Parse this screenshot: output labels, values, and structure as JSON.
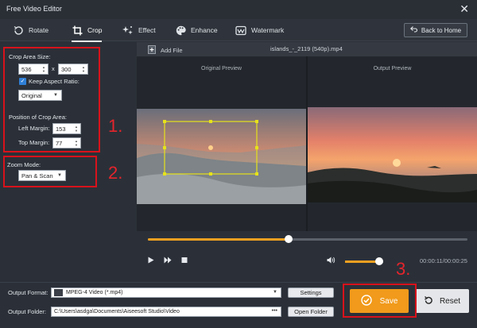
{
  "window": {
    "title": "Free Video Editor",
    "close_glyph": "✕"
  },
  "toolbar": {
    "tabs": [
      {
        "label": "Rotate",
        "icon": "rotate-icon"
      },
      {
        "label": "Crop",
        "icon": "crop-icon",
        "active": true
      },
      {
        "label": "Effect",
        "icon": "effect-icon"
      },
      {
        "label": "Enhance",
        "icon": "palette-icon"
      },
      {
        "label": "Watermark",
        "icon": "watermark-icon"
      }
    ],
    "back_label": "Back to Home"
  },
  "crop": {
    "area_size_label": "Crop Area Size:",
    "width": "536",
    "x_sep": "x",
    "height": "300",
    "keep_aspect_label": "Keep Aspect Ratio:",
    "keep_aspect_checked": true,
    "aspect_value": "Original",
    "position_label": "Position of Crop Area:",
    "left_margin_label": "Left Margin:",
    "left_margin": "153",
    "top_margin_label": "Top Margin:",
    "top_margin": "77",
    "zoom_label": "Zoom Mode:",
    "zoom_value": "Pan & Scan"
  },
  "annotations": {
    "step1": "1.",
    "step2": "2.",
    "step3": "3."
  },
  "file": {
    "add_label": "Add File",
    "name": "islands_-_2119 (540p).mp4"
  },
  "preview": {
    "original_caption": "Original Preview",
    "output_caption": "Output Preview"
  },
  "playback": {
    "progress": 0.44,
    "volume": 0.9,
    "timecode": "00:00:11/00:00:25"
  },
  "output": {
    "format_label": "Output Format:",
    "format_value": "MPEG-4 Video (*.mp4)",
    "settings_label": "Settings",
    "folder_label": "Output Folder:",
    "folder_value": "C:\\Users\\asdga\\Documents\\Aiseesoft Studio\\Video",
    "folder_dots": "•••",
    "open_folder_label": "Open Folder",
    "save_label": "Save",
    "reset_label": "Reset"
  },
  "colors": {
    "accent": "#f19a1b",
    "annotation_red": "#d8121b",
    "bg": "#2b3038"
  }
}
